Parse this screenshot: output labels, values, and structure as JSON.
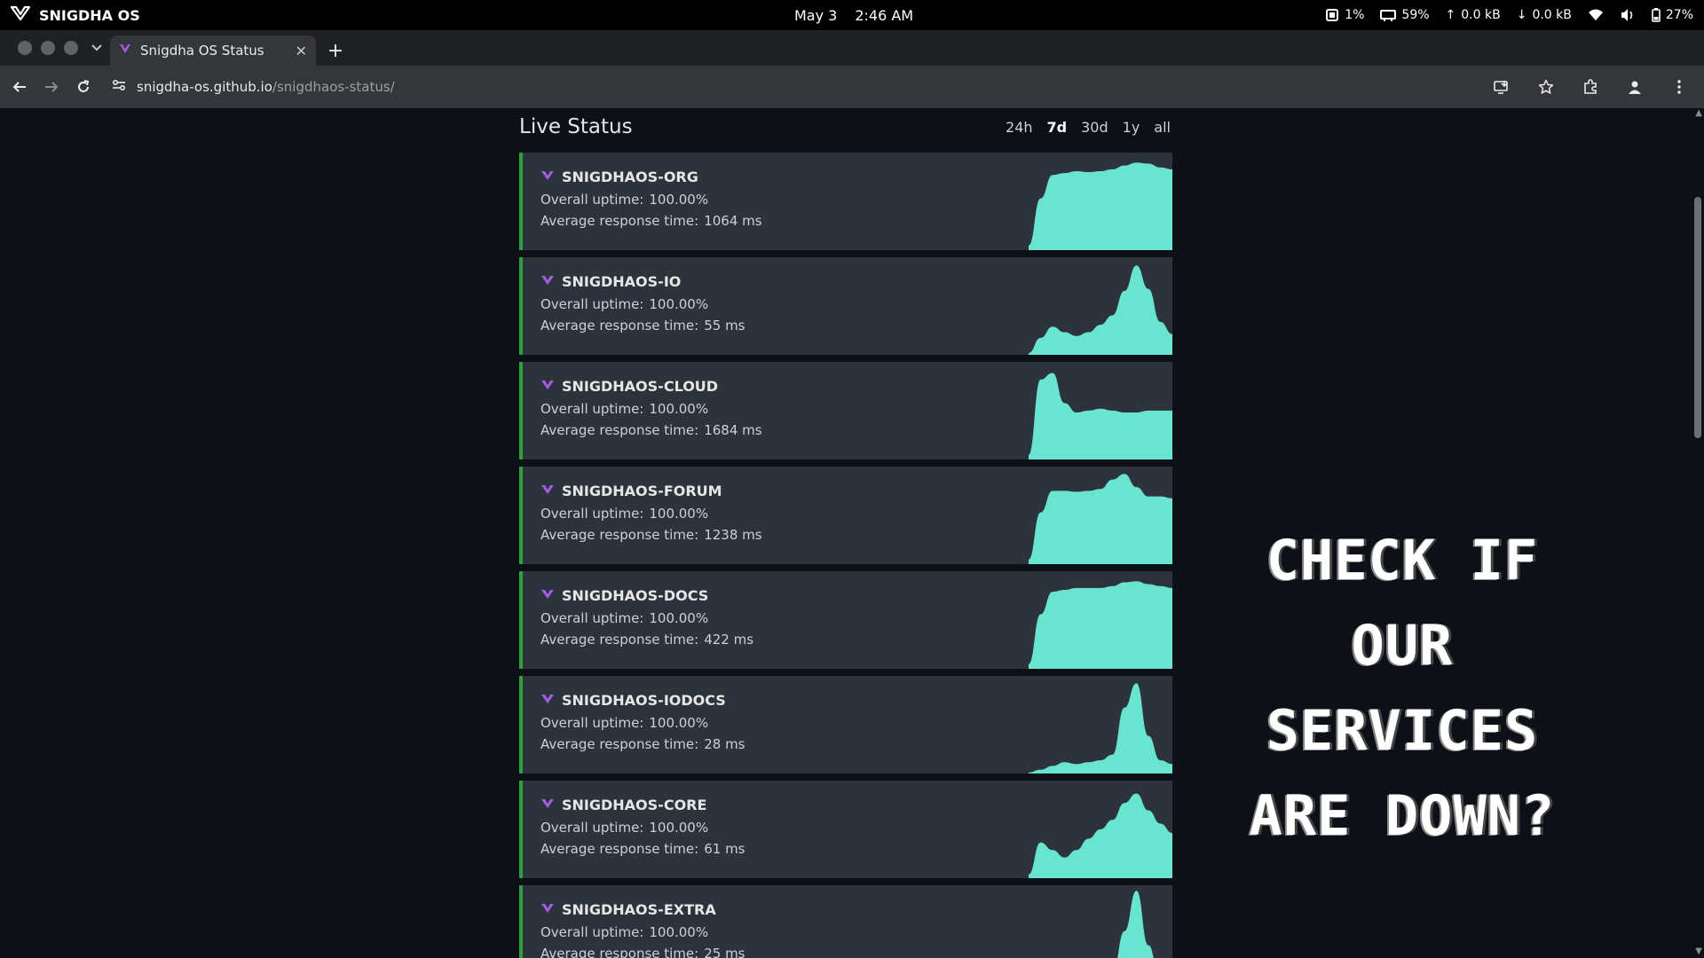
{
  "system": {
    "os_name": "SNIGDHA OS",
    "date": "May 3",
    "time": "2:46 AM",
    "cpu": "1%",
    "memory": "59%",
    "upload": "0.0 kB",
    "download": "0.0 kB",
    "battery": "27%"
  },
  "browser": {
    "tab_title": "Snigdha OS Status",
    "url_host": "snigdha-os.github.io",
    "url_path": "/snigdhaos-status/"
  },
  "status": {
    "title": "Live Status",
    "periods": [
      "24h",
      "7d",
      "30d",
      "1y",
      "all"
    ],
    "active_period": "7d",
    "uptime_label": "Overall uptime:",
    "response_label": "Average response time:",
    "sites": [
      {
        "name": "SNIGDHAOS-ORG",
        "uptime": "100.00%",
        "response": "1064 ms",
        "shape": [
          0.05,
          0.55,
          0.8,
          0.82,
          0.84,
          0.83,
          0.84,
          0.86,
          0.9,
          0.93,
          0.92,
          0.88,
          0.86
        ]
      },
      {
        "name": "SNIGDHAOS-IO",
        "uptime": "100.00%",
        "response": "55 ms",
        "shape": [
          0.02,
          0.18,
          0.3,
          0.24,
          0.2,
          0.24,
          0.32,
          0.42,
          0.68,
          0.95,
          0.7,
          0.35,
          0.22
        ]
      },
      {
        "name": "SNIGDHAOS-CLOUD",
        "uptime": "100.00%",
        "response": "1684 ms",
        "shape": [
          0.05,
          0.85,
          0.92,
          0.6,
          0.5,
          0.52,
          0.54,
          0.52,
          0.5,
          0.5,
          0.52,
          0.52,
          0.52
        ]
      },
      {
        "name": "SNIGDHAOS-FORUM",
        "uptime": "100.00%",
        "response": "1238 ms",
        "shape": [
          0.05,
          0.55,
          0.78,
          0.78,
          0.77,
          0.78,
          0.8,
          0.9,
          0.96,
          0.82,
          0.72,
          0.72,
          0.7
        ]
      },
      {
        "name": "SNIGDHAOS-DOCS",
        "uptime": "100.00%",
        "response": "422 ms",
        "shape": [
          0.05,
          0.58,
          0.82,
          0.84,
          0.86,
          0.86,
          0.86,
          0.88,
          0.92,
          0.93,
          0.9,
          0.88,
          0.86
        ]
      },
      {
        "name": "SNIGDHAOS-IODOCS",
        "uptime": "100.00%",
        "response": "28 ms",
        "shape": [
          0.01,
          0.04,
          0.08,
          0.12,
          0.1,
          0.12,
          0.14,
          0.2,
          0.7,
          0.96,
          0.4,
          0.14,
          0.1
        ]
      },
      {
        "name": "SNIGDHAOS-CORE",
        "uptime": "100.00%",
        "response": "61 ms",
        "shape": [
          0.04,
          0.38,
          0.3,
          0.22,
          0.3,
          0.42,
          0.52,
          0.62,
          0.8,
          0.9,
          0.72,
          0.58,
          0.48
        ]
      },
      {
        "name": "SNIGDHAOS-EXTRA",
        "uptime": "100.00%",
        "response": "25 ms",
        "shape": [
          0.0,
          0.0,
          0.0,
          0.0,
          0.0,
          0.0,
          0.0,
          0.1,
          0.55,
          0.98,
          0.4,
          0.02,
          0.0
        ]
      }
    ]
  },
  "promo": {
    "line1": "CHECK IF OUR",
    "line2": "SERVICES",
    "line3": "ARE DOWN?"
  },
  "colors": {
    "accent": "#68e4d0",
    "up_border": "#2ea043",
    "logo": "#a45be8"
  }
}
